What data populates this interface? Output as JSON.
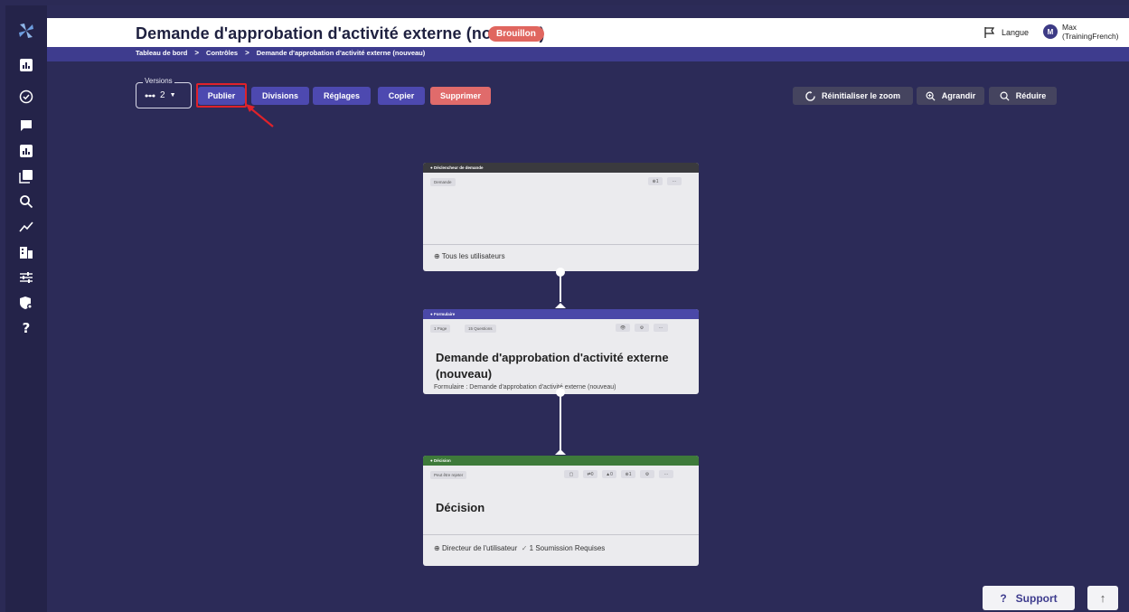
{
  "header": {
    "title": "Demande d'approbation d'activité externe (nouveau)",
    "status": "Brouillon",
    "language_label": "Langue",
    "user_initial": "M",
    "user_name_line1": "Max",
    "user_name_line2": "(TrainingFrench)"
  },
  "breadcrumb": {
    "items": [
      "Tableau de bord",
      "Contrôles",
      "Demande d'approbation d'activité externe (nouveau)"
    ],
    "separator": ">"
  },
  "toolbar": {
    "versions_label": "Versions",
    "versions_value": "2",
    "publish": "Publier",
    "divisions": "Divisions",
    "settings": "Réglages",
    "copy": "Copier",
    "delete": "Supprimer",
    "reset_zoom": "Réinitialiser le zoom",
    "zoom_in": "Agrandir",
    "zoom_out": "Réduire"
  },
  "cards": {
    "trigger": {
      "header": "Déclencheur de demande",
      "chip": "Demande",
      "count": "1",
      "more": "···",
      "footer": "Tous les utilisateurs"
    },
    "form": {
      "header": "Formulaire",
      "pages": "1 Page",
      "questions": "15 Questions",
      "more": "···",
      "title": "Demande d'approbation d'activité externe (nouveau)",
      "subtitle": "Formulaire : Demande d'approbation d'activité externe (nouveau)"
    },
    "decision": {
      "header": "Décision",
      "chip": "Peut être rejeter",
      "c1": "0",
      "c2": "0",
      "c3": "1",
      "more": "···",
      "title": "Décision",
      "footer": "Directeur de l'utilisateur",
      "submissions": "1 Soumission Requises"
    }
  },
  "bottom": {
    "support": "Support"
  },
  "colors": {
    "background": "#2c2b58",
    "primary": "#4d49b0",
    "danger": "#e06b6b",
    "decision_green": "#3e7a3a",
    "trigger_dark": "#3a3a3e"
  }
}
